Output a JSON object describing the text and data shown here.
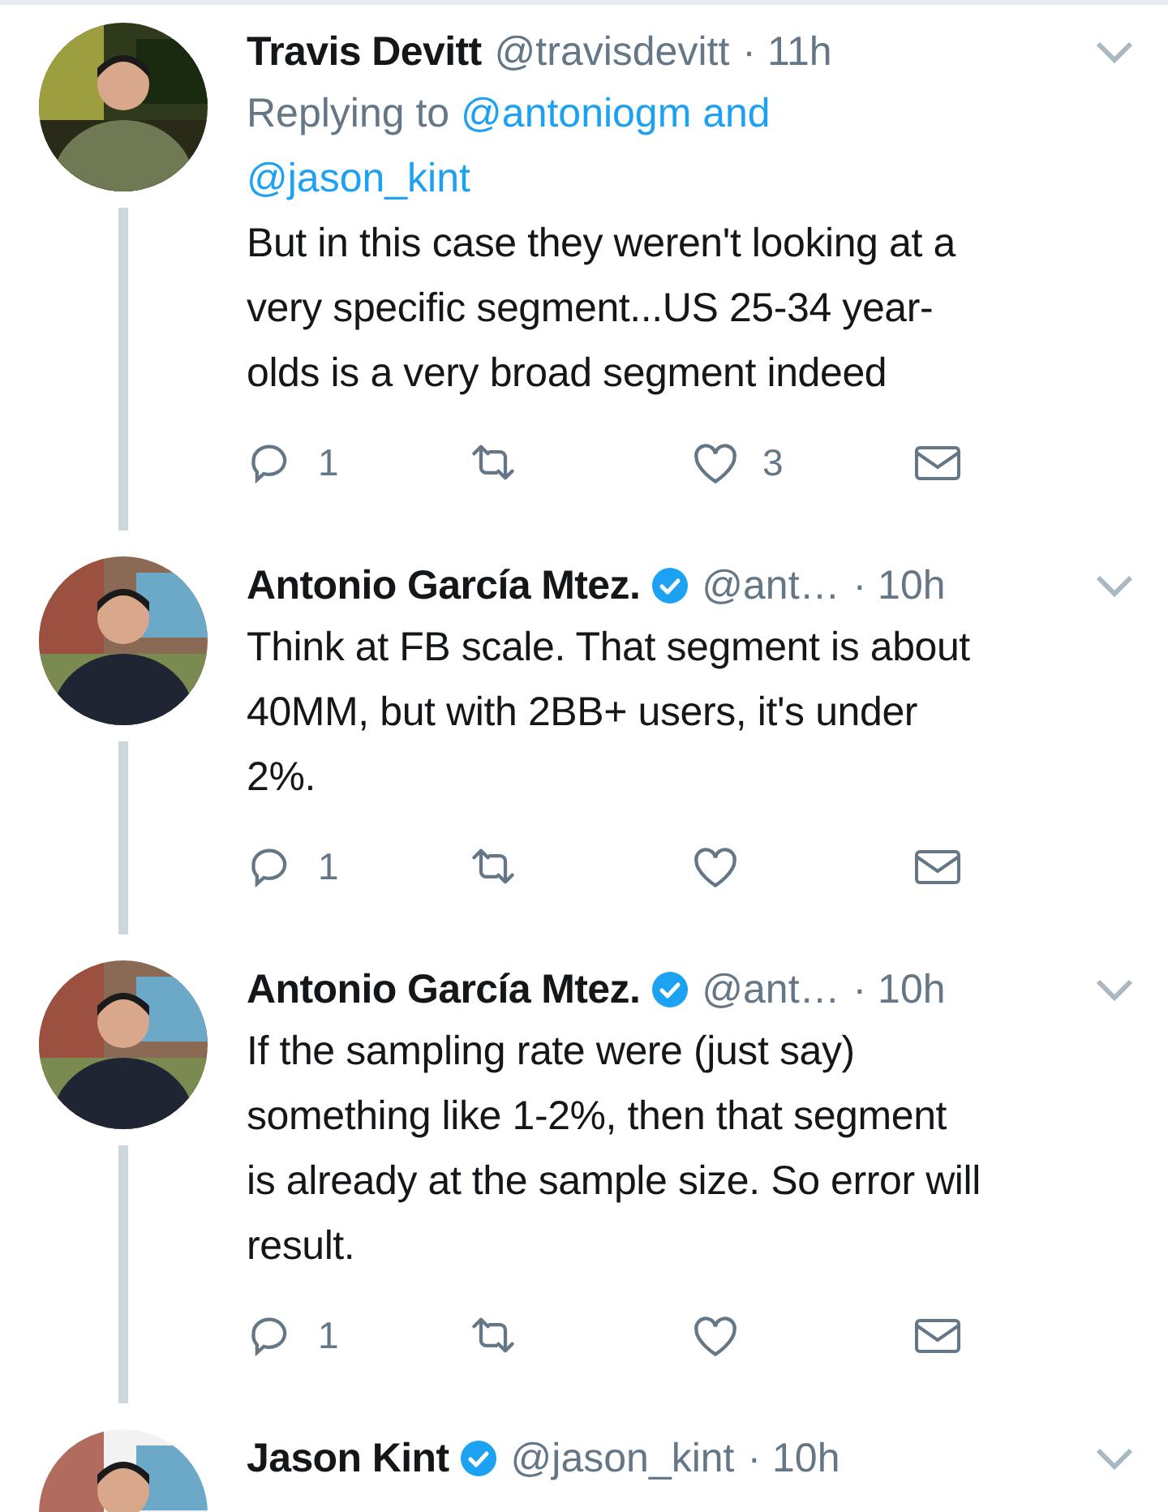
{
  "tweets": [
    {
      "name": "Travis Devitt",
      "verified": false,
      "handle": "@travisdevitt",
      "time": "· 11h",
      "replying": {
        "label": "Replying to",
        "mentions": [
          "@antoniogm and",
          "@jason_kint"
        ]
      },
      "text": "But in this case they weren't looking at a\nvery specific segment...US 25-34 year-\nolds is a very broad segment indeed",
      "reply_count": "1",
      "like_count": "3"
    },
    {
      "name": "Antonio García Mtez.",
      "verified": true,
      "handle": "@ant…",
      "time": "· 10h",
      "text": "Think at FB scale. That segment is about\n40MM, but with 2BB+ users, it's under\n2%.",
      "reply_count": "1"
    },
    {
      "name": "Antonio García Mtez.",
      "verified": true,
      "handle": "@ant…",
      "time": "· 10h",
      "text": "If the sampling rate were (just say)\nsomething like 1-2%, then that segment\nis already at the sample size. So error will\nresult.",
      "reply_count": "1"
    },
    {
      "name": "Jason Kint",
      "verified": true,
      "handle": "@jason_kint",
      "time": "· 10h"
    }
  ]
}
